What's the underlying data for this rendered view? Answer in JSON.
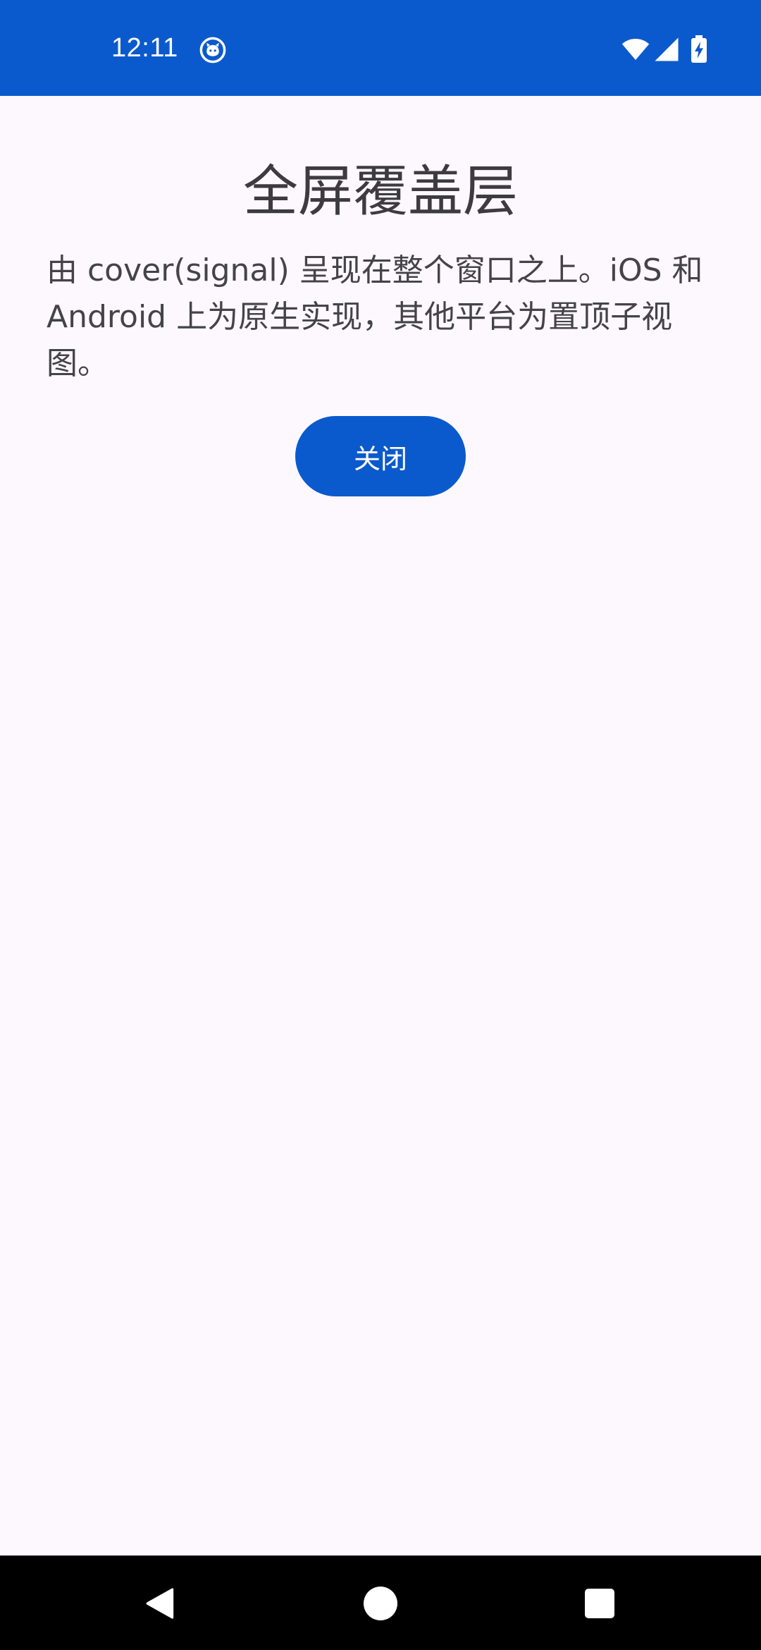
{
  "status_bar": {
    "time": "12:11",
    "app_icon": "notification-app-icon",
    "icons": [
      "wifi-icon",
      "signal-icon",
      "battery-charging-icon"
    ],
    "color": "#0b5acd"
  },
  "overlay": {
    "title": "全屏覆盖层",
    "description": "由 cover(signal) 呈现在整个窗口之上。iOS 和 Android 上为原生实现，其他平台为置顶子视图。",
    "close_label": "关闭",
    "accent_color": "#0b5acd",
    "background_color": "#fdf8fd"
  },
  "nav_bar": {
    "icons": [
      "back-icon",
      "home-icon",
      "recents-icon"
    ]
  }
}
